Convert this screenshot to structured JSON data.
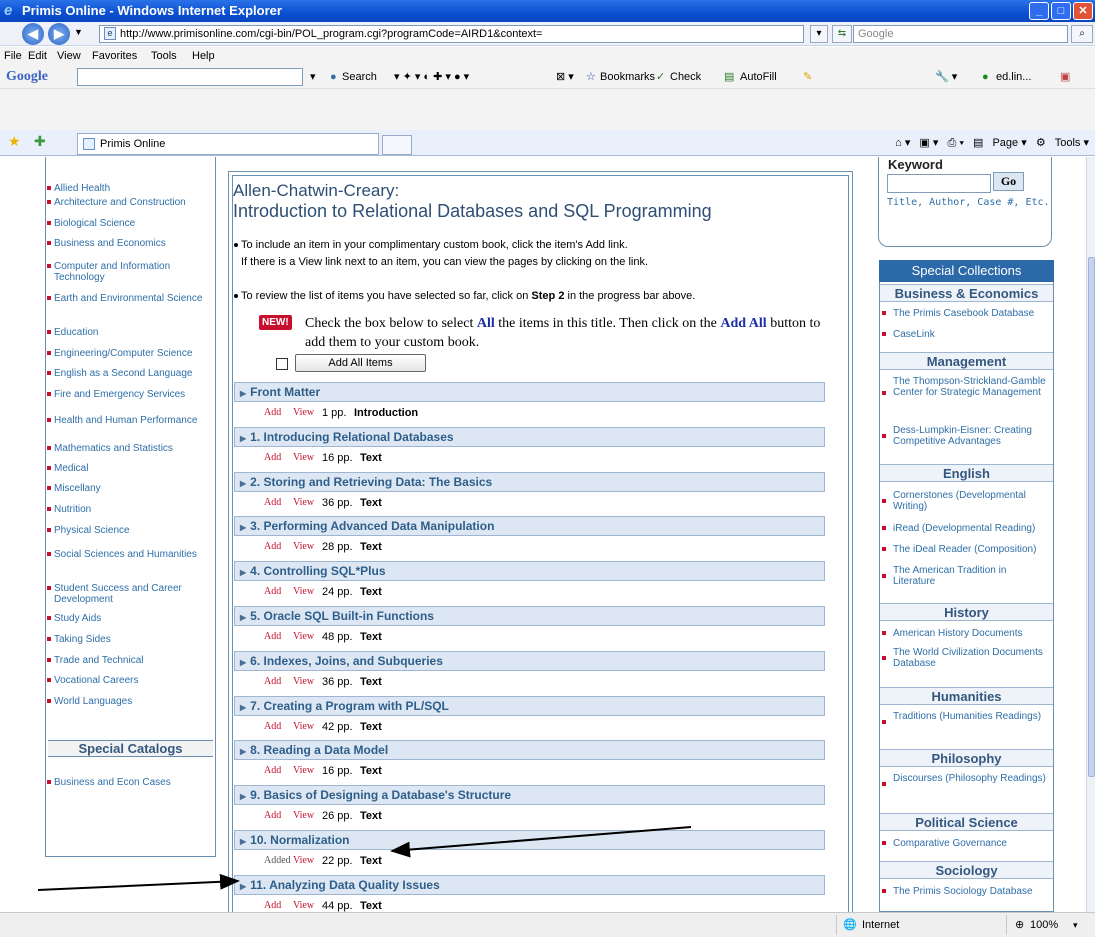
{
  "window": {
    "title": "Primis Online - Windows Internet Explorer"
  },
  "address_bar": {
    "url": "http://www.primisonline.com/cgi-bin/POL_program.cgi?programCode=AIRD1&context=",
    "search_placeholder": "Google"
  },
  "menu": [
    "File",
    "Edit",
    "View",
    "Favorites",
    "Tools",
    "Help"
  ],
  "google_toolbar": {
    "logo": "Google",
    "search_label": "Search",
    "bookmarks_label": "Bookmarks",
    "check_label": "Check",
    "autofill_label": "AutoFill",
    "account_label": "ed.lin..."
  },
  "tab": {
    "title": "Primis Online"
  },
  "command_bar": {
    "page_label": "Page",
    "tools_label": "Tools"
  },
  "status_bar": {
    "zone": "Internet",
    "zoom": "100%"
  },
  "left_panel": {
    "categories": [
      "Allied Health",
      "Architecture and Construction",
      "Biological Science",
      "Business and Economics",
      "Computer and Information Technology",
      "Earth and Environmental Science",
      "Education",
      "Engineering/Computer Science",
      "English as a Second Language",
      "Fire and Emergency Services",
      "Health and Human Performance",
      "Mathematics and Statistics",
      "Medical",
      "Miscellany",
      "Nutrition",
      "Physical Science",
      "Social Sciences and Humanities",
      "Student Success and Career Development",
      "Study Aids",
      "Taking Sides",
      "Trade and Technical",
      "Vocational Careers",
      "World Languages"
    ],
    "special_catalogs_title": "Special Catalogs",
    "special_catalogs": [
      "Business and Econ Cases"
    ]
  },
  "main": {
    "title_line1": "Allen-Chatwin-Creary:",
    "title_line2": "Introduction to Relational Databases and SQL Programming",
    "bullet1_line1": "To include an item in your complimentary custom book, click the item's Add link.",
    "bullet1_line2": "If there is a View link next to an item, you can view the pages by clicking on the link.",
    "bullet2_pre": "To review the list of items you have selected so far, click on ",
    "bullet2_bold": "Step 2",
    "bullet2_post": " in the progress bar above.",
    "new_badge": "NEW!",
    "new_text_1": "Check the box below to select ",
    "new_text_all": "All",
    "new_text_2": " the items in this title. Then click on the ",
    "new_text_addall": "Add All",
    "new_text_3": " button to add them to your custom book.",
    "add_all_button": "Add All Items",
    "chapters": [
      {
        "title": "Front Matter",
        "add": "Add",
        "view": "View",
        "pages": "1 pp.",
        "type": "Introduction"
      },
      {
        "title": "1. Introducing Relational Databases",
        "add": "Add",
        "view": "View",
        "pages": "16 pp.",
        "type": "Text"
      },
      {
        "title": "2. Storing and Retrieving Data: The Basics",
        "add": "Add",
        "view": "View",
        "pages": "36 pp.",
        "type": "Text"
      },
      {
        "title": "3. Performing Advanced Data Manipulation",
        "add": "Add",
        "view": "View",
        "pages": "28 pp.",
        "type": "Text"
      },
      {
        "title": "4. Controlling SQL*Plus",
        "add": "Add",
        "view": "View",
        "pages": "24 pp.",
        "type": "Text"
      },
      {
        "title": "5. Oracle SQL Built-in Functions",
        "add": "Add",
        "view": "View",
        "pages": "48 pp.",
        "type": "Text"
      },
      {
        "title": "6. Indexes, Joins, and Subqueries",
        "add": "Add",
        "view": "View",
        "pages": "36 pp.",
        "type": "Text"
      },
      {
        "title": "7. Creating a Program with PL/SQL",
        "add": "Add",
        "view": "View",
        "pages": "42 pp.",
        "type": "Text"
      },
      {
        "title": "8. Reading a Data Model",
        "add": "Add",
        "view": "View",
        "pages": "16 pp.",
        "type": "Text"
      },
      {
        "title": "9. Basics of Designing a Database's Structure",
        "add": "Add",
        "view": "View",
        "pages": "26 pp.",
        "type": "Text"
      },
      {
        "title": "10. Normalization",
        "add": "Added",
        "view": "View",
        "pages": "22 pp.",
        "type": "Text"
      },
      {
        "title": "11. Analyzing Data Quality Issues",
        "add": "Add",
        "view": "View",
        "pages": "44 pp.",
        "type": "Text"
      }
    ]
  },
  "right_panel": {
    "keyword_label": "Keyword",
    "go_button": "Go",
    "keyword_hint": "Title, Author, Case #, Etc.",
    "special_collections_title": "Special Collections",
    "sections": [
      {
        "title": "Business & Economics",
        "items": [
          "The Primis Casebook Database",
          "CaseLink"
        ]
      },
      {
        "title": "Management",
        "items": [
          "The Thompson-Strickland-Gamble Center for Strategic Management",
          "Dess-Lumpkin-Eisner: Creating Competitive Advantages"
        ]
      },
      {
        "title": "English",
        "items": [
          "Cornerstones (Developmental Writing)",
          "iRead (Developmental Reading)",
          "The iDeal Reader (Composition)",
          "The American Tradition in Literature"
        ]
      },
      {
        "title": "History",
        "items": [
          "American History Documents",
          "The World Civilization Documents Database"
        ]
      },
      {
        "title": "Humanities",
        "items": [
          "Traditions (Humanities Readings)"
        ]
      },
      {
        "title": "Philosophy",
        "items": [
          "Discourses (Philosophy Readings)"
        ]
      },
      {
        "title": "Political Science",
        "items": [
          "Comparative Governance"
        ]
      },
      {
        "title": "Sociology",
        "items": [
          "The Primis Sociology Database"
        ]
      }
    ]
  }
}
